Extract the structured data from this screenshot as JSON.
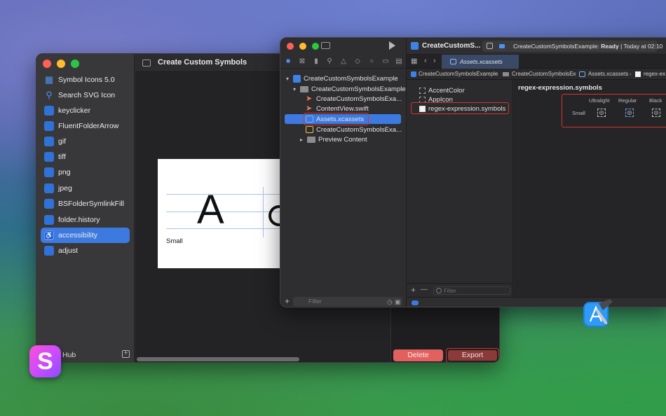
{
  "symbol_app": {
    "title": "Create Custom Symbols",
    "sidebar": {
      "items": [
        {
          "label": "Symbol Icons 5.0",
          "icon": "grid-icon"
        },
        {
          "label": "Search SVG Icon",
          "icon": "search-icon"
        },
        {
          "label": "keyclicker",
          "icon": "folder-icon"
        },
        {
          "label": "FluentFolderArrow",
          "icon": "folder-icon"
        },
        {
          "label": "gif",
          "icon": "folder-icon"
        },
        {
          "label": "tiff",
          "icon": "folder-icon"
        },
        {
          "label": "png",
          "icon": "folder-icon"
        },
        {
          "label": "jpeg",
          "icon": "folder-icon"
        },
        {
          "label": "BSFolderSymlinkFill",
          "icon": "folder-icon"
        },
        {
          "label": "folder.history",
          "icon": "folder-icon"
        },
        {
          "label": "accessibility",
          "icon": "accessibility-icon",
          "selected": true
        },
        {
          "label": "adjust",
          "icon": "folder-icon"
        }
      ],
      "footer_label": "Hub"
    },
    "canvas": {
      "glyph": "A",
      "size_label": "Small"
    },
    "buttons": {
      "delete": "Delete",
      "export": "Export"
    }
  },
  "xcode": {
    "scheme": "CreateCustomS...",
    "status": {
      "project": "CreateCustomSymbolsExample:",
      "state": "Ready",
      "time": "| Today at 02:10"
    },
    "tab": "Assets.xcassets",
    "jump_bar": [
      "CreateCustomSymbolsExample",
      "CreateCustomSymbolsEx",
      "Assets.xcassets",
      "regex-ex"
    ],
    "navigator": {
      "rows": [
        {
          "label": "CreateCustomSymbolsExample",
          "kind": "project",
          "indent": 0,
          "expanded": true
        },
        {
          "label": "CreateCustomSymbolsExample",
          "kind": "folder",
          "indent": 1,
          "expanded": true
        },
        {
          "label": "CreateCustomSymbolsExa...",
          "kind": "swift",
          "indent": 2
        },
        {
          "label": "ContentView.swift",
          "kind": "swift",
          "indent": 2
        },
        {
          "label": "Assets.xcassets",
          "kind": "assets",
          "indent": 2,
          "selected": true
        },
        {
          "label": "CreateCustomSymbolsExa...",
          "kind": "preview",
          "indent": 2
        },
        {
          "label": "Preview Content",
          "kind": "folder",
          "indent": 2,
          "expanded": false
        }
      ],
      "filter_placeholder": "Filter"
    },
    "asset_list": {
      "items": [
        {
          "label": "AccentColor",
          "kind": "color"
        },
        {
          "label": "AppIcon",
          "kind": "appicon"
        },
        {
          "label": "regex-expression.symbols",
          "kind": "symbol",
          "selected": true
        }
      ],
      "filter_placeholder": "Filter",
      "add": "+",
      "remove": "—"
    },
    "detail": {
      "title": "regex-expression.symbols",
      "weights": [
        "Ultralight",
        "Regular",
        "Black"
      ],
      "row_label": "Small"
    }
  },
  "colors": {
    "accent": "#3d7ae0",
    "highlight_outline": "#d6342c",
    "delete": "#e2615f"
  }
}
